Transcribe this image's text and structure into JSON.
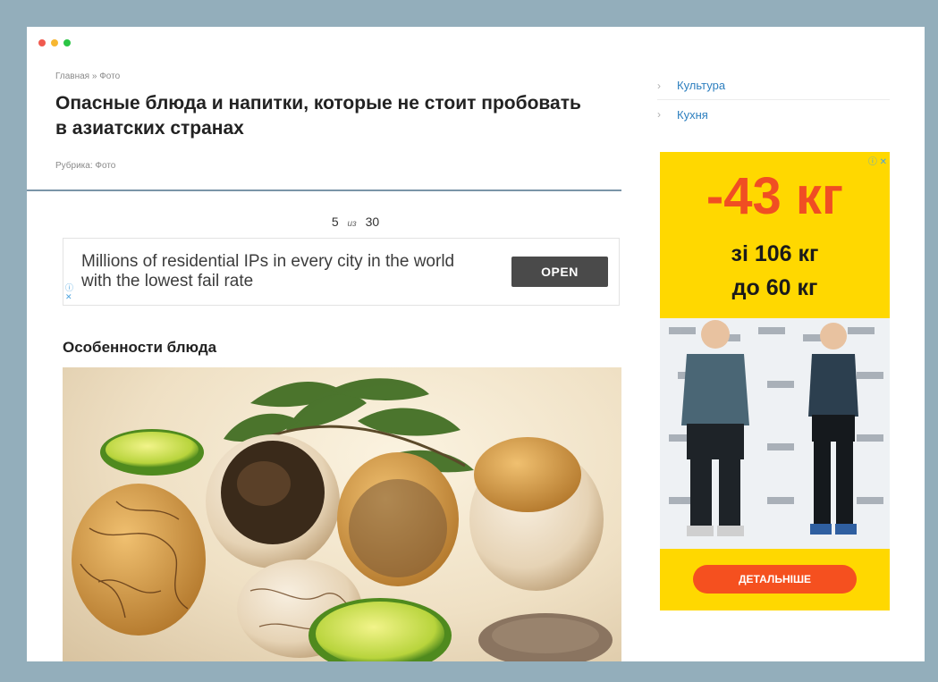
{
  "window_controls": [
    "close",
    "minimize",
    "maximize"
  ],
  "breadcrumb": {
    "home": "Главная",
    "separator": "»",
    "current": "Фото"
  },
  "article": {
    "title": "Опасные блюда и напитки, которые не стоит пробовать в азиатских странах",
    "rubric": "Рубрика: Фото"
  },
  "gallery": {
    "current": "5",
    "of_label": "из",
    "total": "30"
  },
  "ad_banner": {
    "text": "Millions of residential IPs in every city in the world with the lowest fail rate",
    "button_label": "OPEN",
    "adchoices_icons": [
      "info-icon",
      "close-icon"
    ]
  },
  "section": {
    "heading": "Особенности блюда"
  },
  "photo": {
    "subject": "balut-eggs-photo"
  },
  "sidebar": {
    "items": [
      {
        "label": "Культура"
      },
      {
        "label": "Кухня"
      }
    ]
  },
  "side_ad": {
    "headline": "-43 кг",
    "from_text": "зі 106 кг",
    "to_text": "до 60 кг",
    "button_label": "ДЕТАЛЬНІШЕ",
    "accent_color": "#f04e23",
    "background_color": "#ffd800"
  }
}
